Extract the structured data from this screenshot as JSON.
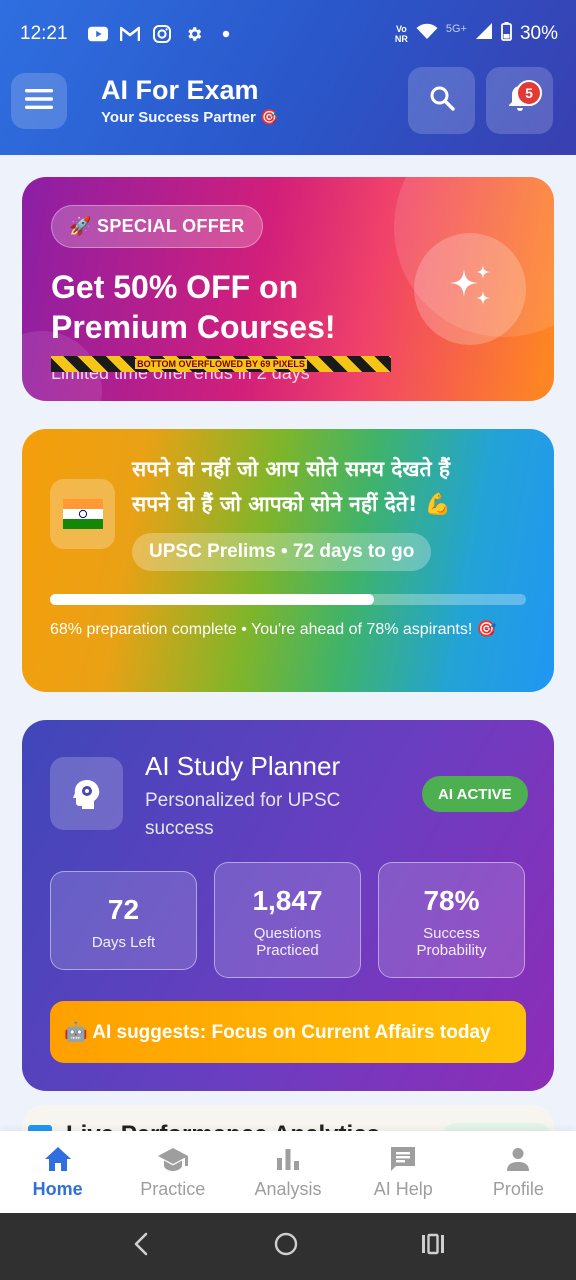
{
  "status_bar": {
    "time": "12:21",
    "icons": [
      "youtube-icon",
      "gmail-icon",
      "instagram-icon",
      "settings-icon",
      "dot-icon"
    ],
    "volte": "Vo\nNR",
    "network": "5G+",
    "battery": "30%"
  },
  "app_bar": {
    "title": "AI For Exam",
    "subtitle": "Your Success Partner 🎯",
    "notification_count": "5"
  },
  "offer_card": {
    "badge": "🚀 SPECIAL OFFER",
    "title": "Get 50% OFF on Premium Courses!",
    "subtitle": "Limited time offer ends in 2 days",
    "overflow_warning": "BOTTOM OVERFLOWED BY 69 PIXELS"
  },
  "motivation_card": {
    "flag": "🇮🇳",
    "quote_line1": "सपने वो नहीं जो आप सोते समय देखते हैं",
    "quote_line2": "सपने वो हैं जो आपको सोने नहीं देते! 💪",
    "countdown": "UPSC Prelims • 72 days to go",
    "progress_fraction": 0.68,
    "progress_text": "68% preparation complete • You're ahead of 78% aspirants! 🎯"
  },
  "planner_card": {
    "title": "AI Study Planner",
    "subtitle": "Personalized for UPSC success",
    "badge": "AI ACTIVE",
    "stats": [
      {
        "value": "72",
        "label": "Days Left"
      },
      {
        "value": "1,847",
        "label": "Questions Practiced"
      },
      {
        "value": "78%",
        "label": "Success Probability"
      }
    ],
    "suggestion": "🤖 AI suggests: Focus on Current Affairs today"
  },
  "next_section": {
    "title": "Live Performance Analytics"
  },
  "bottom_nav": [
    {
      "label": "Home",
      "icon": "home-icon",
      "active": true
    },
    {
      "label": "Practice",
      "icon": "school-icon",
      "active": false
    },
    {
      "label": "Analysis",
      "icon": "bar-chart-icon",
      "active": false
    },
    {
      "label": "AI Help",
      "icon": "chat-icon",
      "active": false
    },
    {
      "label": "Profile",
      "icon": "person-icon",
      "active": false
    }
  ],
  "colors": {
    "primary": "#2f6fe0",
    "badge_red": "#e53935",
    "ai_active_green": "#4caf50",
    "suggestion_amber": "#ffa000"
  }
}
